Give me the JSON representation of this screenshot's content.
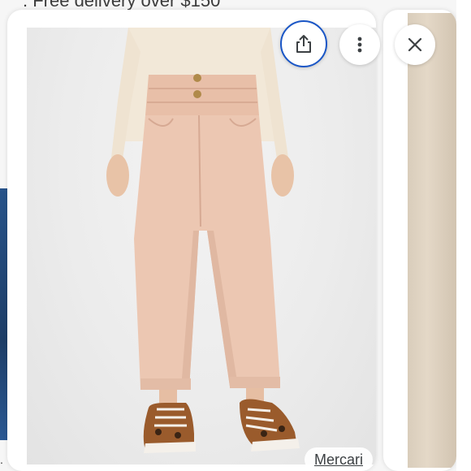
{
  "background": {
    "delivery_text": ": Free delivery over $150",
    "edge_mark": "."
  },
  "card": {
    "image_description_icon": "pink-jeans-photo",
    "source_label": "Mercari"
  },
  "buttons": {
    "share_icon": "share-icon",
    "more_icon": "more-vert-icon",
    "close_icon": "close-icon"
  },
  "colors": {
    "focus_ring": "#1a56c6",
    "icon": "#3c4043",
    "card_bg": "#ffffff"
  }
}
